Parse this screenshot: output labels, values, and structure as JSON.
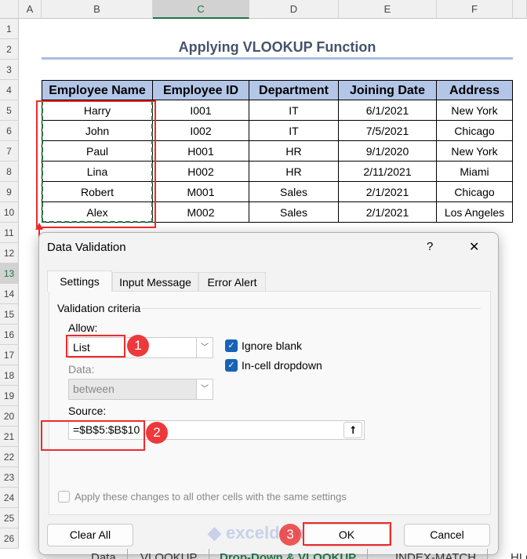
{
  "columns": [
    "A",
    "B",
    "C",
    "D",
    "E",
    "F"
  ],
  "rows": [
    "1",
    "2",
    "3",
    "4",
    "5",
    "6",
    "7",
    "8",
    "9",
    "10",
    "11",
    "12",
    "13",
    "14",
    "15",
    "16",
    "17",
    "18",
    "19",
    "20",
    "21",
    "22",
    "23",
    "24",
    "25",
    "26"
  ],
  "title": "Applying VLOOKUP Function",
  "table": {
    "headers": [
      "Employee Name",
      "Employee ID",
      "Department",
      "Joining Date",
      "Address"
    ],
    "rows": [
      [
        "Harry",
        "I001",
        "IT",
        "6/1/2021",
        "New York"
      ],
      [
        "John",
        "I002",
        "IT",
        "7/5/2021",
        "Chicago"
      ],
      [
        "Paul",
        "H001",
        "HR",
        "9/1/2020",
        "New York"
      ],
      [
        "Lina",
        "H002",
        "HR",
        "2/11/2021",
        "Miami"
      ],
      [
        "Robert",
        "M001",
        "Sales",
        "2/1/2021",
        "Chicago"
      ],
      [
        "Alex",
        "M002",
        "Sales",
        "2/1/2021",
        "Los Angeles"
      ]
    ]
  },
  "dialog": {
    "title": "Data Validation",
    "help": "?",
    "close": "✕",
    "tabs": [
      "Settings",
      "Input Message",
      "Error Alert"
    ],
    "section": "Validation criteria",
    "allow_label": "Allow:",
    "allow_value": "List",
    "ignore_blank": "Ignore blank",
    "in_cell_dropdown": "In-cell dropdown",
    "ignore_blank_checked": true,
    "in_cell_dropdown_checked": true,
    "data_label": "Data:",
    "data_value": "between",
    "source_label": "Source:",
    "source_value": "=$B$5:$B$10",
    "apply_all": "Apply these changes to all other cells with the same settings",
    "clear_all": "Clear All",
    "ok": "OK",
    "cancel": "Cancel"
  },
  "badges": [
    "1",
    "2",
    "3"
  ],
  "watermark": "exceldemy EXCEL · DATA · BI",
  "sheet_tabs": [
    "Data",
    "VLOOKUP",
    "Drop-Down & VLOOKUP",
    "INDEX-MATCH",
    "HLO"
  ],
  "colors": {
    "accent": "#217346",
    "header_fill": "#b4c6e7",
    "annotation": "#ee2b2b",
    "checkbox": "#1763b5"
  }
}
